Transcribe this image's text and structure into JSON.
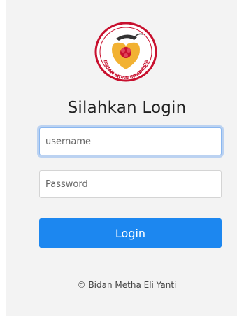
{
  "logo": {
    "icon": "ikatan-bidan-indonesia-logo",
    "text": "IKATAN BIDAN INDONESIA",
    "colors": {
      "ring": "#c8102e",
      "inner": "#f2b233",
      "fill": "#ffffff"
    }
  },
  "form": {
    "heading": "Silahkan Login",
    "username_placeholder": "username",
    "password_placeholder": "Password",
    "login_label": "Login"
  },
  "footer": {
    "copyright": "© Bidan Metha Eli Yanti"
  },
  "colors": {
    "primary": "#1c87f0",
    "background": "#f3f3f3",
    "focus_ring": "#8ab7f0"
  }
}
